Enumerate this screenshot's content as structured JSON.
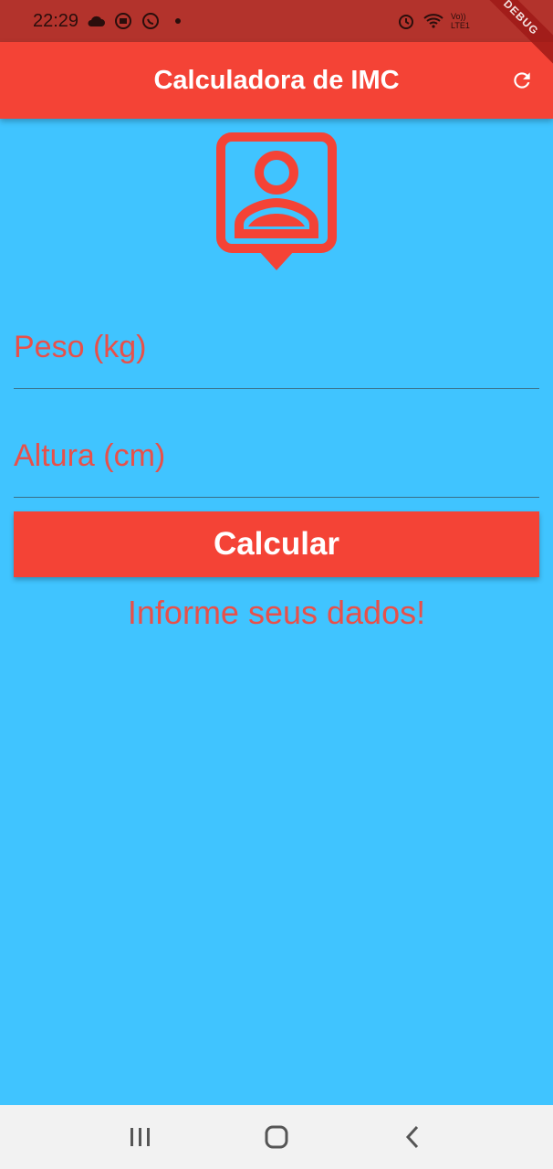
{
  "status_bar": {
    "time": "22:29",
    "left_icons": [
      "cloud-icon",
      "chat-bubble-icon",
      "whatsapp-icon",
      "dot-icon"
    ],
    "right_icons": [
      "alarm-icon",
      "wifi-icon",
      "volte-lte-icon",
      "signal-icon"
    ],
    "volte_label": "Vo)) LTE1"
  },
  "app_bar": {
    "title": "Calculadora de IMC",
    "debug_label": "DEBUG"
  },
  "form": {
    "peso_placeholder": "Peso (kg)",
    "peso_value": "",
    "altura_placeholder": "Altura (cm)",
    "altura_value": "",
    "button_label": "Calcular"
  },
  "info_text": "Informe seus dados!",
  "colors": {
    "primary": "#F44336",
    "background": "#40C4FF",
    "status_bar": "#B3332C"
  }
}
